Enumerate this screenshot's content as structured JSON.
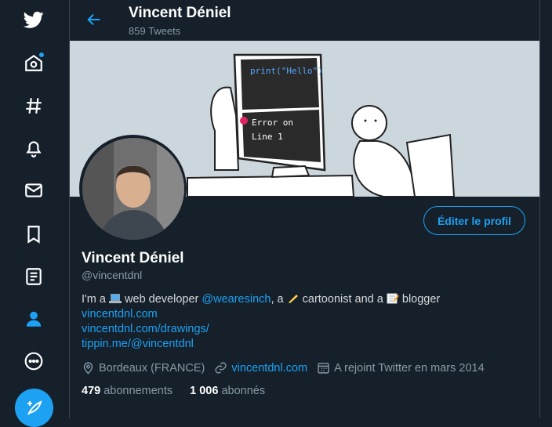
{
  "nav": {
    "items": [
      "home",
      "explore",
      "notifications",
      "messages",
      "bookmarks",
      "lists",
      "profile",
      "more"
    ]
  },
  "header": {
    "name": "Vincent Déniel",
    "tweet_count": "859 Tweets"
  },
  "banner": {
    "code_text": "print(\"Hello\")",
    "error_line1": "Error on",
    "error_line2": "Line 1"
  },
  "profile": {
    "edit_label": "Éditer le profil",
    "name": "Vincent Déniel",
    "handle": "@vincentdnl",
    "bio": {
      "part1": "I'm a",
      "part2": "web developer",
      "mention": "@wearesinch",
      "part3": ", a",
      "part4": "cartoonist and a",
      "part5": "blogger",
      "links": [
        "vincentdnl.com",
        "vincentdnl.com/drawings/",
        "tippin.me/@vincentdnl"
      ]
    },
    "location": "Bordeaux (FRANCE)",
    "website": "vincentdnl.com",
    "joined": "A rejoint Twitter en mars 2014",
    "following_count": "479",
    "following_label": "abonnements",
    "followers_count": "1 006",
    "followers_label": "abonnés"
  },
  "colors": {
    "background": "#15202b",
    "accent": "#1da1f2",
    "secondary_text": "#8899a6",
    "border": "#38444d"
  }
}
